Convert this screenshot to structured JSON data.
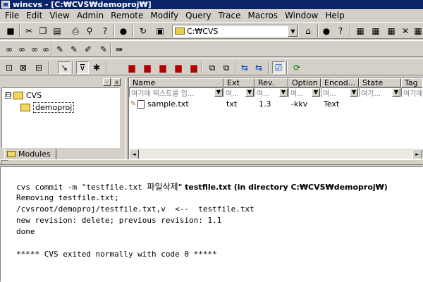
{
  "window": {
    "title": "wincvs - [C:₩CVS₩demoproj₩]"
  },
  "menu": [
    "File",
    "Edit",
    "View",
    "Admin",
    "Remote",
    "Modify",
    "Query",
    "Trace",
    "Macros",
    "Window",
    "Help"
  ],
  "toolbar": {
    "path": "C:₩CVS"
  },
  "tree": {
    "root_label": "CVS",
    "root_expander": "⊟",
    "child_label": "demoproj",
    "tab_label": "Modules",
    "pin_symbol": "-",
    "close_symbol": "x"
  },
  "filelist": {
    "columns": [
      "Name",
      "Ext",
      "Rev.",
      "Option",
      "Encod...",
      "State",
      "Tag"
    ],
    "filter_placeholders": [
      "여기에 텍스트를 입...",
      "여...",
      "여...",
      "여...",
      "여...",
      "여기...",
      "여기에"
    ],
    "filter_button": "▼",
    "row": {
      "name": "sample.txt",
      "ext": "txt",
      "rev": "1.3",
      "option": "-kkv",
      "encoding": "Text",
      "state": "",
      "tag": ""
    },
    "scroll_left": "◄",
    "scroll_right": "►"
  },
  "console": {
    "cmd_prefix": "cvs commit -m \"testfile.txt ",
    "cmd_korean": "파일삭제",
    "cmd_suffix": "\" testfile.txt (in directory C:₩CVS₩demoproj₩)",
    "lines": [
      "Removing testfile.txt;",
      "/cvsroot/demoproj/testfile.txt,v  <--  testfile.txt",
      "new revision: delete; previous revision: 1.1",
      "done",
      "",
      "***** CVS exited normally with code 0 *****"
    ]
  },
  "icons": {
    "tb1": [
      "save-icon",
      "cut-icon",
      "copy-icon",
      "paste-icon",
      "print-icon",
      "search-icon",
      "help-icon",
      "stop-icon",
      "reload-icon",
      "browse-icon",
      "open-folder-icon",
      "record-icon",
      "question-icon",
      "panel-icon",
      "panel2-icon",
      "panel3-icon",
      "close-x-icon",
      "panel4-icon"
    ],
    "tb1_glyphs": [
      "■",
      "✂",
      "❐",
      "▤",
      "⎙",
      "⚲",
      "?",
      "●",
      "↻",
      "▣",
      "⌂",
      "●",
      "?",
      "▦",
      "▦",
      "▦",
      "✕",
      "▦"
    ],
    "tb2_glyphs": [
      "∞",
      "∞",
      "∞",
      "∞",
      "✎",
      "✎",
      "✐",
      "✎",
      "⇛"
    ],
    "tb3_glyphs": [
      "⊡",
      "⊠",
      "⊟",
      "↘",
      "⊽",
      "✱",
      "▆",
      "▆",
      "▆",
      "▆",
      "▆",
      "⧉",
      "⧉",
      "⇆",
      "⇆",
      "☑",
      "⟳"
    ]
  }
}
